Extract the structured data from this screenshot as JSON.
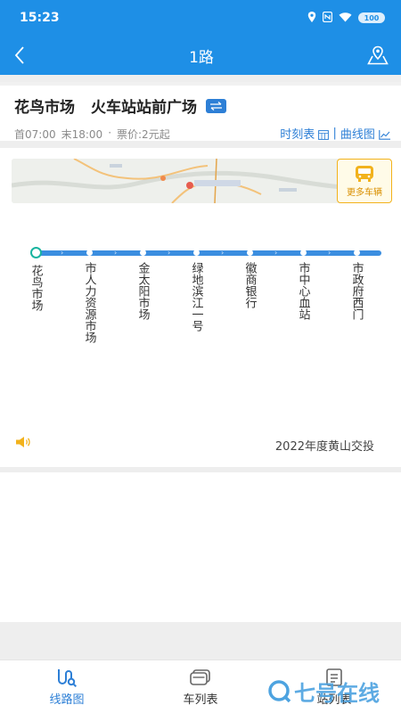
{
  "status_bar": {
    "time": "15:23",
    "battery": "100"
  },
  "app_bar": {
    "title": "1路"
  },
  "route": {
    "from": "花鸟市场",
    "to": "火车站站前广场",
    "first_bus": "首07:00",
    "last_bus": "末18:00",
    "dot": "·",
    "fare": "票价:2元起",
    "timetable_label": "时刻表",
    "separator": "|",
    "curve_label": "曲线图"
  },
  "map": {
    "more_buses_label": "更多车辆"
  },
  "stops": [
    "花鸟市场",
    "市人力资源市场",
    "金太阳市场",
    "绿地滨江一号",
    "徽商银行",
    "市中心血站",
    "市政府西门"
  ],
  "operator_note": "2022年度黄山交投",
  "bottom_nav": {
    "items": [
      {
        "label": "线路图",
        "active": true
      },
      {
        "label": "车列表",
        "active": false
      },
      {
        "label": "站列表",
        "active": false
      }
    ]
  },
  "watermark": "七号在线",
  "colors": {
    "primary": "#1e8fe6",
    "line": "#3b8ee0",
    "first_stop": "#19b4a0",
    "accent_yellow": "#f2b21c"
  }
}
